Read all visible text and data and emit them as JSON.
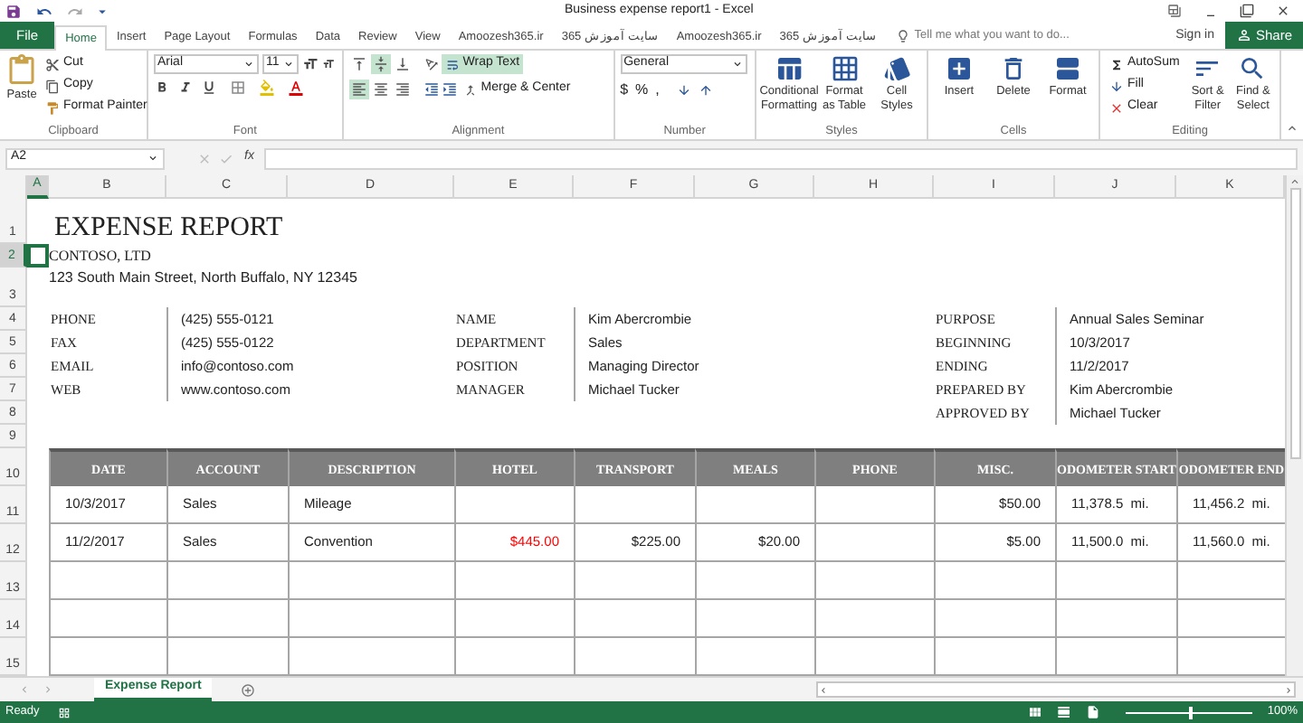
{
  "window": {
    "title": "Business expense report1 - Excel"
  },
  "file_tab": "File",
  "tabs": [
    {
      "label": "Home",
      "selected": true
    },
    {
      "label": "Insert",
      "selected": false
    },
    {
      "label": "Page Layout",
      "selected": false
    },
    {
      "label": "Formulas",
      "selected": false
    },
    {
      "label": "Data",
      "selected": false
    },
    {
      "label": "Review",
      "selected": false
    },
    {
      "label": "View",
      "selected": false
    },
    {
      "label": "Amoozesh365.ir",
      "selected": false
    },
    {
      "label": "سایت آموزش 365",
      "selected": false
    },
    {
      "label": "Amoozesh365.ir",
      "selected": false
    },
    {
      "label": "سایت آموزش 365",
      "selected": false
    }
  ],
  "tell_me": {
    "placeholder": "Tell me what you want to do..."
  },
  "sign_in": "Sign in",
  "share": "Share",
  "ribbon": {
    "clipboard": {
      "label": "Clipboard",
      "paste": "Paste",
      "cut": "Cut",
      "copy": "Copy",
      "format_painter": "Format Painter"
    },
    "font": {
      "label": "Font",
      "font_name": "Arial",
      "font_size": "11"
    },
    "alignment": {
      "label": "Alignment",
      "vertical": [
        {
          "kind": "top",
          "selected": false
        },
        {
          "kind": "middle",
          "selected": true
        },
        {
          "kind": "bottom",
          "selected": false
        }
      ],
      "horizontal": [
        {
          "kind": "left",
          "selected": true
        },
        {
          "kind": "center",
          "selected": false
        },
        {
          "kind": "right",
          "selected": false
        }
      ],
      "wrap_text": {
        "label": "Wrap Text",
        "on": true
      },
      "merge": "Merge & Center"
    },
    "number": {
      "label": "Number",
      "format": "General",
      "currency": "$",
      "percent": "%",
      "comma": ","
    },
    "styles": {
      "label": "Styles",
      "buttons": [
        "Conditional Formatting",
        "Format as Table",
        "Cell Styles"
      ]
    },
    "cells": {
      "label": "Cells",
      "buttons": [
        "Insert",
        "Delete",
        "Format"
      ]
    },
    "editing": {
      "label": "Editing",
      "autosum": "AutoSum",
      "fill": "Fill",
      "clear": "Clear",
      "sort": "Sort & Filter",
      "find": "Find & Select"
    }
  },
  "formula_bar": {
    "name_box": "A2",
    "fx": "fx"
  },
  "columns": [
    {
      "label": "A",
      "selected": true
    },
    {
      "label": "B",
      "selected": false
    },
    {
      "label": "C",
      "selected": false
    },
    {
      "label": "D",
      "selected": false
    },
    {
      "label": "E",
      "selected": false
    },
    {
      "label": "F",
      "selected": false
    },
    {
      "label": "G",
      "selected": false
    },
    {
      "label": "H",
      "selected": false
    },
    {
      "label": "I",
      "selected": false
    },
    {
      "label": "J",
      "selected": false
    },
    {
      "label": "K",
      "selected": false
    }
  ],
  "rows": [
    {
      "label": "1",
      "selected": false
    },
    {
      "label": "2",
      "selected": true
    },
    {
      "label": "3",
      "selected": false
    },
    {
      "label": "4",
      "selected": false
    },
    {
      "label": "5",
      "selected": false
    },
    {
      "label": "6",
      "selected": false
    },
    {
      "label": "7",
      "selected": false
    },
    {
      "label": "8",
      "selected": false
    },
    {
      "label": "9",
      "selected": false
    },
    {
      "label": "10",
      "selected": false
    },
    {
      "label": "11",
      "selected": false
    },
    {
      "label": "12",
      "selected": false
    },
    {
      "label": "13",
      "selected": false
    },
    {
      "label": "14",
      "selected": false
    },
    {
      "label": "15",
      "selected": false
    }
  ],
  "sheet": {
    "title": "EXPENSE REPORT",
    "company": "CONTOSO, LTD",
    "address": "123 South Main Street, North Buffalo, NY 12345",
    "contact": [
      {
        "label": "PHONE",
        "value": "(425) 555-0121"
      },
      {
        "label": "FAX",
        "value": "(425) 555-0122"
      },
      {
        "label": "EMAIL",
        "value": "info@contoso.com"
      },
      {
        "label": "WEB",
        "value": "www.contoso.com"
      }
    ],
    "employee": [
      {
        "label": "NAME",
        "value": "Kim Abercrombie"
      },
      {
        "label": "DEPARTMENT",
        "value": "Sales"
      },
      {
        "label": "POSITION",
        "value": "Managing Director"
      },
      {
        "label": "MANAGER",
        "value": "Michael Tucker"
      }
    ],
    "trip": [
      {
        "label": "PURPOSE",
        "value": "Annual Sales Seminar"
      },
      {
        "label": "BEGINNING",
        "value": "10/3/2017"
      },
      {
        "label": "ENDING",
        "value": "11/2/2017"
      },
      {
        "label": "PREPARED BY",
        "value": "Kim Abercrombie"
      },
      {
        "label": "APPROVED BY",
        "value": "Michael Tucker"
      }
    ],
    "table": {
      "columns": [
        "DATE",
        "ACCOUNT",
        "DESCRIPTION",
        "HOTEL",
        "TRANSPORT",
        "MEALS",
        "PHONE",
        "MISC.",
        "ODOMETER START",
        "ODOMETER END"
      ],
      "rows": [
        [
          {
            "text": "10/3/2017"
          },
          {
            "text": "Sales"
          },
          {
            "text": "Mileage"
          },
          null,
          null,
          null,
          null,
          {
            "text": "$50.00"
          },
          {
            "text": "11,378.5  mi."
          },
          {
            "text": "11,456.2  mi."
          }
        ],
        [
          {
            "text": "11/2/2017"
          },
          {
            "text": "Sales"
          },
          {
            "text": "Convention"
          },
          {
            "text": "$445.00",
            "color": "#ff0000"
          },
          {
            "text": "$225.00"
          },
          {
            "text": "$20.00"
          },
          null,
          {
            "text": "$5.00"
          },
          {
            "text": "11,500.0  mi."
          },
          {
            "text": "11,560.0  mi."
          }
        ]
      ]
    }
  },
  "sheet_tabs": [
    {
      "label": "Expense Report",
      "selected": true
    }
  ],
  "status": {
    "text": "Ready",
    "zoom": "100%",
    "zoom_slider": {
      "level": 0.5
    }
  }
}
